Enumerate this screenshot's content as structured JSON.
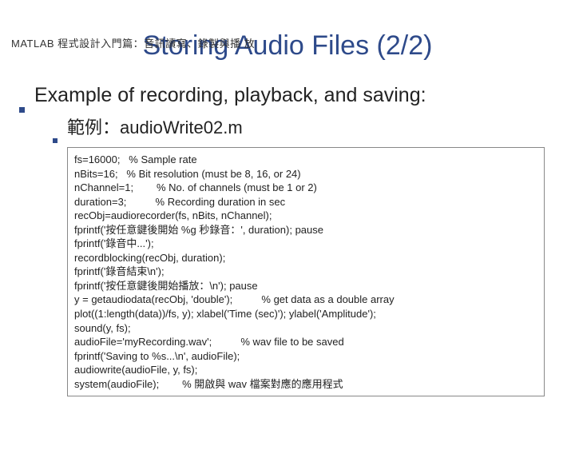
{
  "header": "MATLAB 程式設計入門篇：音訊讀寫、錄製與播 放",
  "title": "Storing Audio Files (2/2)",
  "bullet1": "Example of recording, playback, and saving:",
  "bullet2": "範例：audioWrite02.m",
  "code": [
    "fs=16000;   % Sample rate",
    "nBits=16;   % Bit resolution (must be 8, 16, or 24)",
    "nChannel=1;        % No. of channels (must be 1 or 2)",
    "duration=3;          % Recording duration in sec",
    "recObj=audiorecorder(fs, nBits, nChannel);",
    "fprintf('按任意鍵後開始 %g 秒錄音：', duration); pause",
    "fprintf('錄音中...');",
    "recordblocking(recObj, duration);",
    "fprintf('錄音結束\\n');",
    "fprintf('按任意鍵後開始播放：\\n'); pause",
    "y = getaudiodata(recObj, 'double');          % get data as a double array",
    "plot((1:length(data))/fs, y); xlabel('Time (sec)'); ylabel('Amplitude');",
    "sound(y, fs);",
    "audioFile='myRecording.wav';          % wav file to be saved",
    "fprintf('Saving to %s...\\n', audioFile);",
    "audiowrite(audioFile, y, fs);",
    "system(audioFile);        % 開啟與 wav 檔案對應的應用程式"
  ]
}
